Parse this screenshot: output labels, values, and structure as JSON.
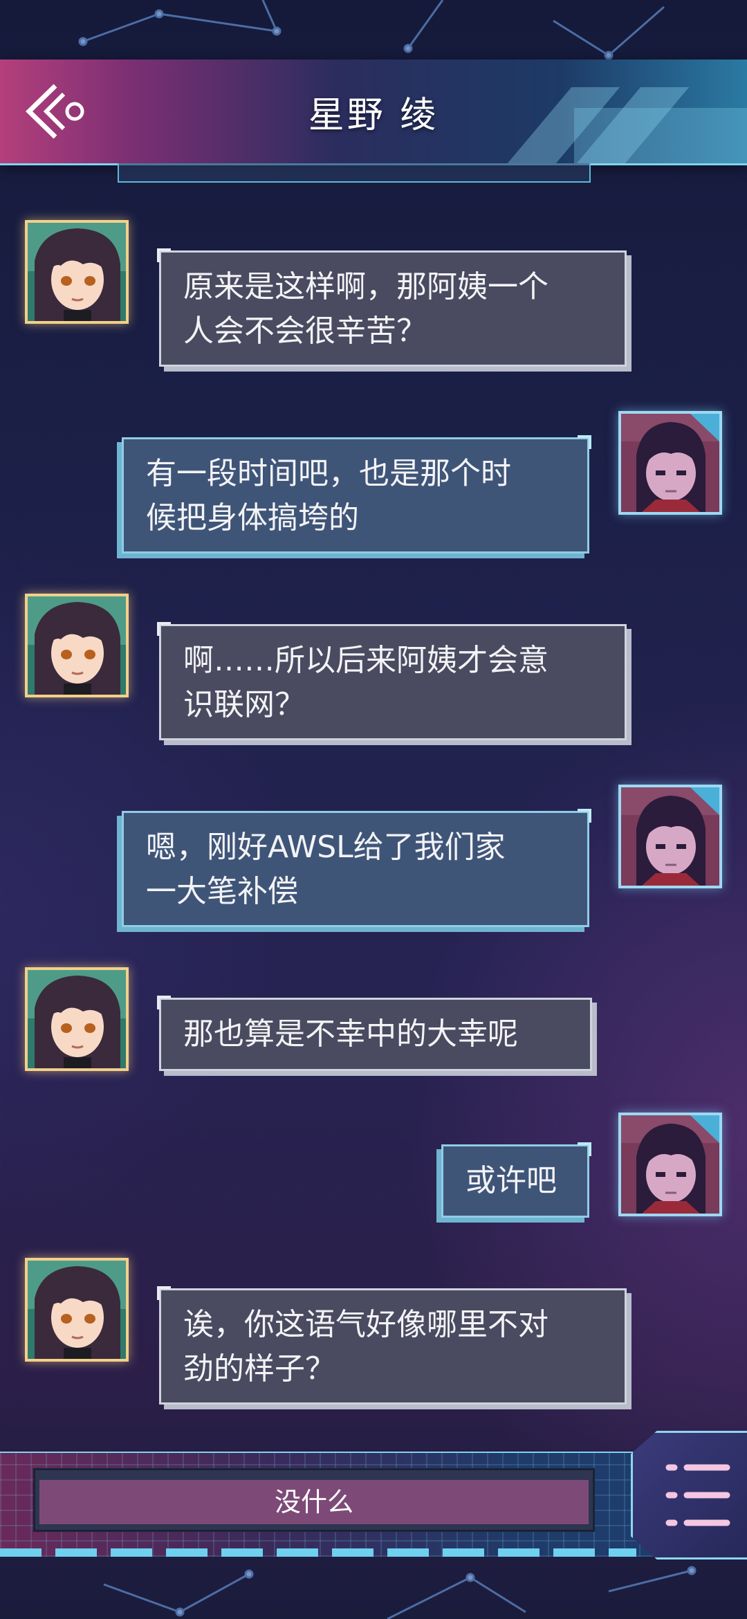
{
  "header": {
    "title": "星野 绫",
    "back_icon": "back-arrow-icon"
  },
  "messages": [
    {
      "speaker": "npc",
      "avatar": "girl-avatar",
      "text_lines": [
        "原来是这样啊，那阿姨一个",
        "人会不会很辛苦？"
      ]
    },
    {
      "speaker": "me",
      "avatar": "boy-avatar",
      "text_lines": [
        "有一段时间吧，也是那个时",
        "候把身体搞垮的"
      ]
    },
    {
      "speaker": "npc",
      "avatar": "girl-avatar",
      "text_lines": [
        "啊……所以后来阿姨才会意",
        "识联网？"
      ]
    },
    {
      "speaker": "me",
      "avatar": "boy-avatar",
      "text_lines": [
        "嗯，刚好AWSL给了我们家",
        "一大笔补偿"
      ]
    },
    {
      "speaker": "npc",
      "avatar": "girl-avatar",
      "text_lines": [
        "那也算是不幸中的大幸呢"
      ]
    },
    {
      "speaker": "me",
      "avatar": "boy-avatar",
      "text_lines": [
        "或许吧"
      ]
    },
    {
      "speaker": "npc",
      "avatar": "girl-avatar",
      "text_lines": [
        "诶，你这语气好像哪里不对",
        "劲的样子？"
      ]
    }
  ],
  "choice": {
    "label": "没什么"
  },
  "menu": {
    "icon": "menu-icon"
  },
  "colors": {
    "npc_frame": "#f2d08a",
    "me_frame": "#9fd8f2",
    "choice_fill": "#7d4a78"
  }
}
